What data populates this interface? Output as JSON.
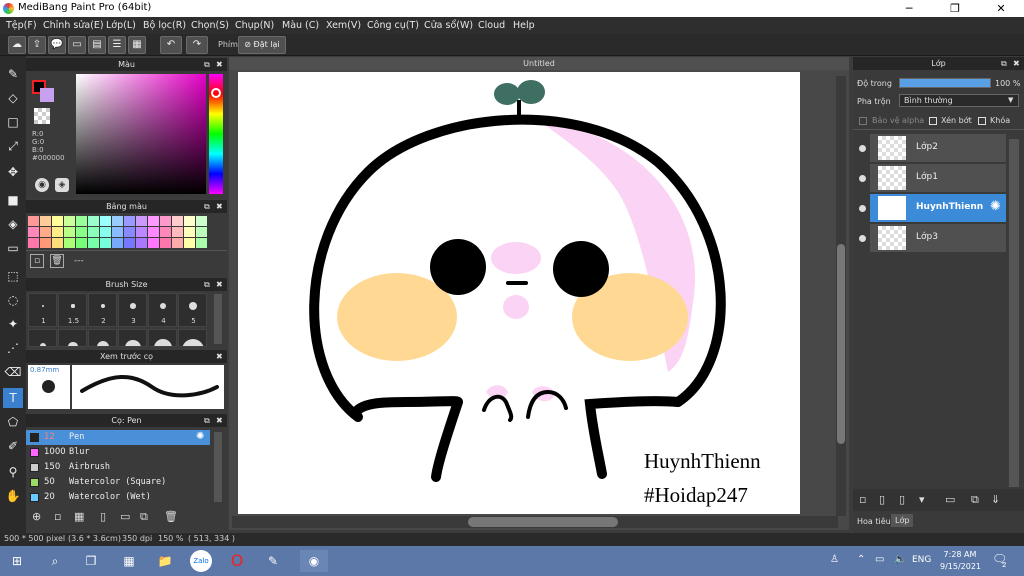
{
  "window": {
    "title": "MediBang Paint Pro (64bit)",
    "minimize_icon": "minimize-icon",
    "maximize_icon": "maximize-icon",
    "close_icon": "close-icon"
  },
  "menu": [
    "Tệp(F)",
    "Chỉnh sửa(E)",
    "Lớp(L)",
    "Bộ lọc(R)",
    "Chọn(S)",
    "Chụp(N)",
    "Màu (C)",
    "Xem(V)",
    "Công cụ(T)",
    "Cửa sổ(W)",
    "Cloud",
    "Help"
  ],
  "toolbar": {
    "phim_label": "Phím",
    "reset_label": "Đặt lại"
  },
  "color_panel": {
    "title": "Màu",
    "r": "R:0",
    "g": "G:0",
    "b": "B:0",
    "hex": "#000000"
  },
  "palette_panel": {
    "title": "Bảng màu",
    "value": "---"
  },
  "brush_size_panel": {
    "title": "Brush Size",
    "sizes": [
      "1",
      "1.5",
      "2",
      "3",
      "4",
      "5"
    ]
  },
  "preview_panel": {
    "title": "Xem trước cọ",
    "size": "0.87mm"
  },
  "brush_panel": {
    "title": "Cọ: Pen",
    "brushes": [
      {
        "size": "12",
        "name": "Pen",
        "color": "#222222"
      },
      {
        "size": "1000",
        "name": "Blur",
        "color": "#ff66ff"
      },
      {
        "size": "150",
        "name": "Airbrush",
        "color": "#cccccc"
      },
      {
        "size": "50",
        "name": "Watercolor (Square)",
        "color": "#99dd66"
      },
      {
        "size": "20",
        "name": "Watercolor (Wet)",
        "color": "#66ccff"
      }
    ]
  },
  "canvas": {
    "tab": "Untitled",
    "text_line1": "HuynhThienn",
    "text_line2": "#Hoidap247"
  },
  "layer_panel": {
    "title": "Lớp",
    "opacity_label": "Độ trong",
    "opacity_value": "100 %",
    "opacity": 1.0,
    "blend_label": "Pha trộn",
    "blend_value": "Bình thường",
    "protect_alpha": "Bảo vệ alpha",
    "clipping": "Xén bớt",
    "lock": "Khóa",
    "layers": [
      "Lớp2",
      "Lớp1",
      "HuynhThienn",
      "Lớp3"
    ],
    "tab_hoatieu": "Hoa tiêu",
    "tab_lop": "Lớp"
  },
  "status": {
    "size": "500 * 500 pixel",
    "cm": "(3.6 * 3.6cm)",
    "dpi": "350 dpi",
    "zoom": "150 %",
    "coords": "( 513, 334 )"
  },
  "taskbar": {
    "time": "7:28 AM",
    "date": "9/15/2021",
    "lang": "ENG",
    "notif": "2"
  }
}
